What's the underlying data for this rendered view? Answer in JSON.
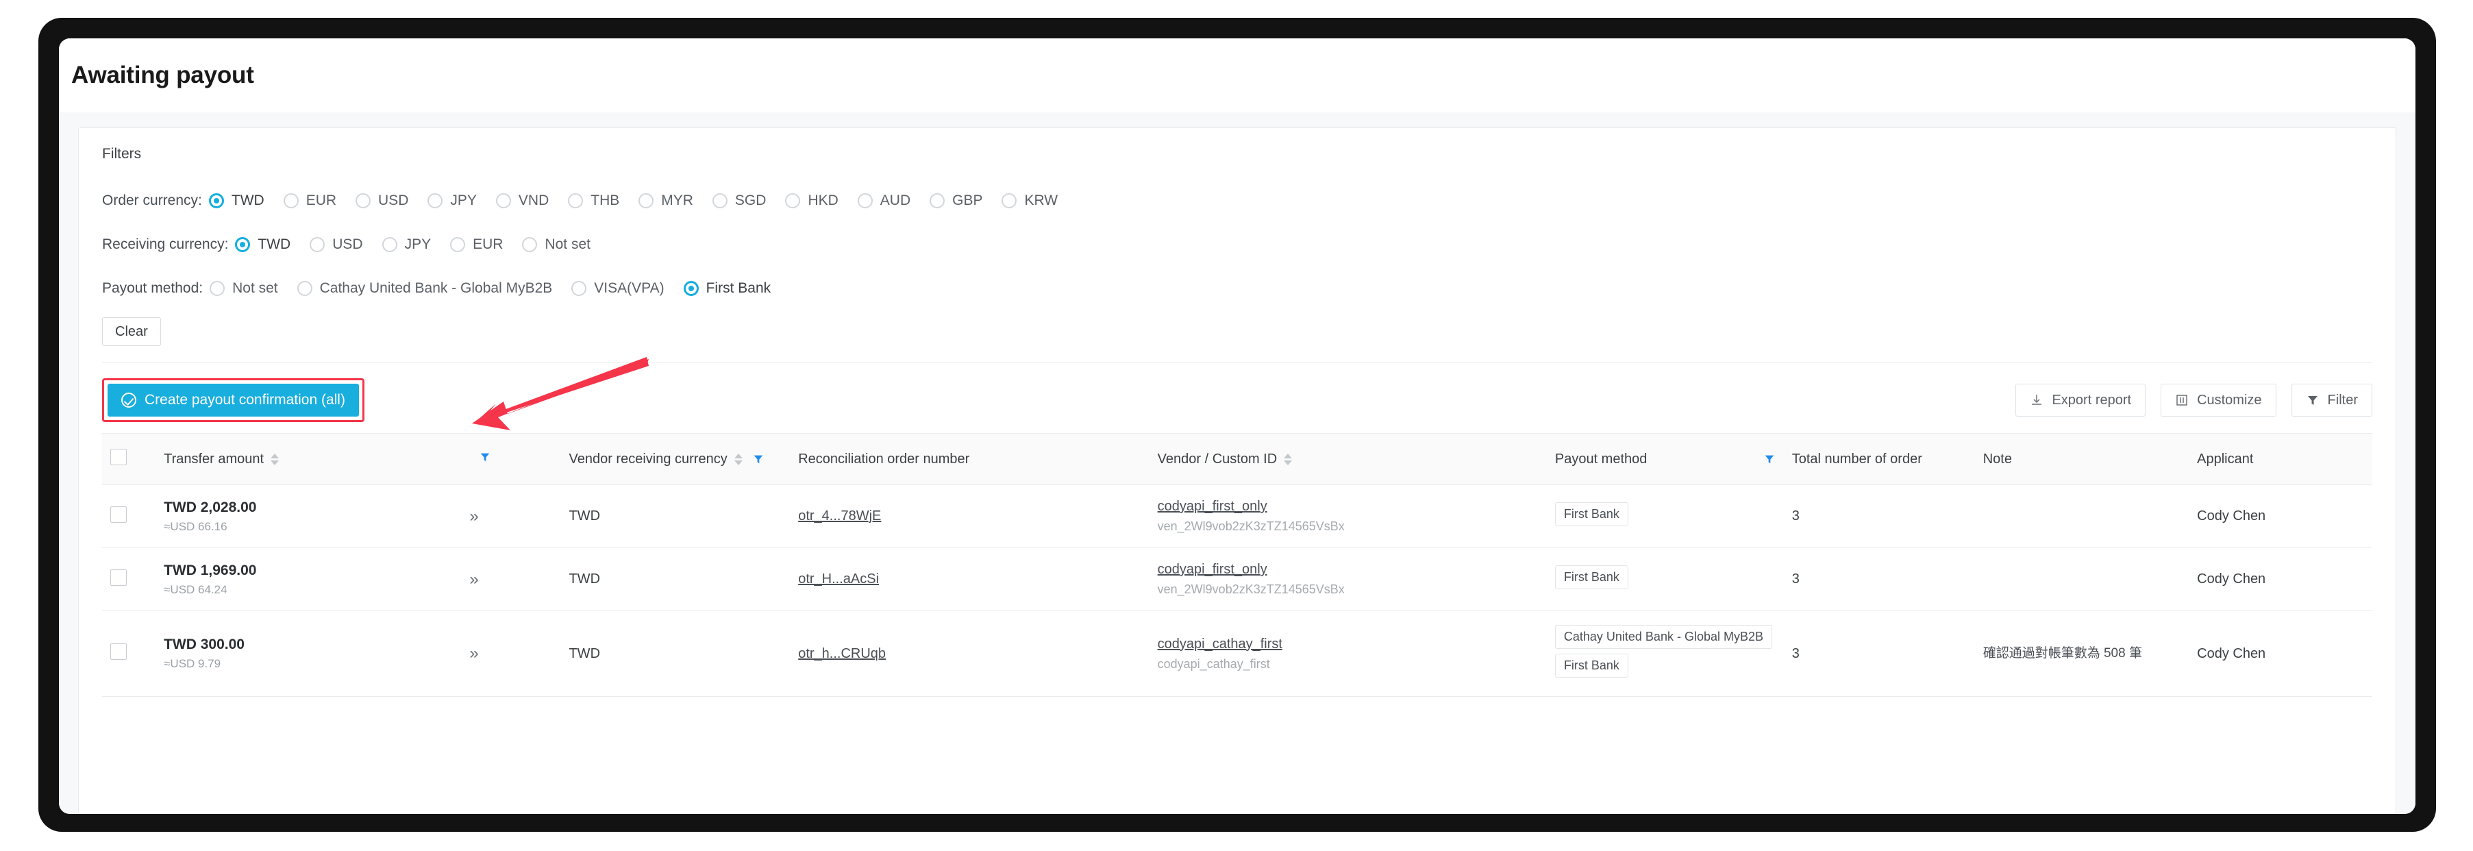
{
  "page": {
    "title": "Awaiting payout"
  },
  "filters": {
    "heading": "Filters",
    "rows": [
      {
        "label": "Order currency:",
        "options": [
          "TWD",
          "EUR",
          "USD",
          "JPY",
          "VND",
          "THB",
          "MYR",
          "SGD",
          "HKD",
          "AUD",
          "GBP",
          "KRW"
        ],
        "selected": "TWD"
      },
      {
        "label": "Receiving currency:",
        "options": [
          "TWD",
          "USD",
          "JPY",
          "EUR",
          "Not set"
        ],
        "selected": "TWD"
      },
      {
        "label": "Payout method:",
        "options": [
          "Not set",
          "Cathay United Bank - Global MyB2B",
          "VISA(VPA)",
          "First Bank"
        ],
        "selected": "First Bank"
      }
    ],
    "clear_label": "Clear"
  },
  "toolbar": {
    "primary_label": "Create payout confirmation (all)",
    "export_label": "Export report",
    "customize_label": "Customize",
    "filter_label": "Filter"
  },
  "table": {
    "headers": [
      "Transfer amount",
      "Vendor receiving currency",
      "Reconciliation order number",
      "Vendor / Custom ID",
      "Payout method",
      "Total number of order",
      "Note",
      "Applicant"
    ],
    "rows": [
      {
        "amount": "TWD 2,028.00",
        "amount_usd": "≈USD 66.16",
        "chevron": "»",
        "receiving_currency": "TWD",
        "order_number": "otr_4...78WjE",
        "vendor_name": "codyapi_first_only",
        "vendor_id": "ven_2Wl9vob2zK3zTZ14565VsBx",
        "payout_tags": [
          "First Bank"
        ],
        "order_count": "3",
        "note": "",
        "applicant": "Cody Chen"
      },
      {
        "amount": "TWD 1,969.00",
        "amount_usd": "≈USD 64.24",
        "chevron": "»",
        "receiving_currency": "TWD",
        "order_number": "otr_H...aAcSi",
        "vendor_name": "codyapi_first_only",
        "vendor_id": "ven_2Wl9vob2zK3zTZ14565VsBx",
        "payout_tags": [
          "First Bank"
        ],
        "order_count": "3",
        "note": "",
        "applicant": "Cody Chen"
      },
      {
        "amount": "TWD 300.00",
        "amount_usd": "≈USD 9.79",
        "chevron": "»",
        "receiving_currency": "TWD",
        "order_number": "otr_h...CRUqb",
        "vendor_name": "codyapi_cathay_first",
        "vendor_id": "codyapi_cathay_first",
        "payout_tags": [
          "Cathay United Bank - Global MyB2B",
          "First Bank"
        ],
        "order_count": "3",
        "note": "確認通過對帳筆數為 508 筆",
        "applicant": "Cody Chen"
      }
    ]
  },
  "colors": {
    "accent": "#18aedd",
    "highlight": "#f5354a",
    "filter_icon": "#1f8ceb"
  }
}
